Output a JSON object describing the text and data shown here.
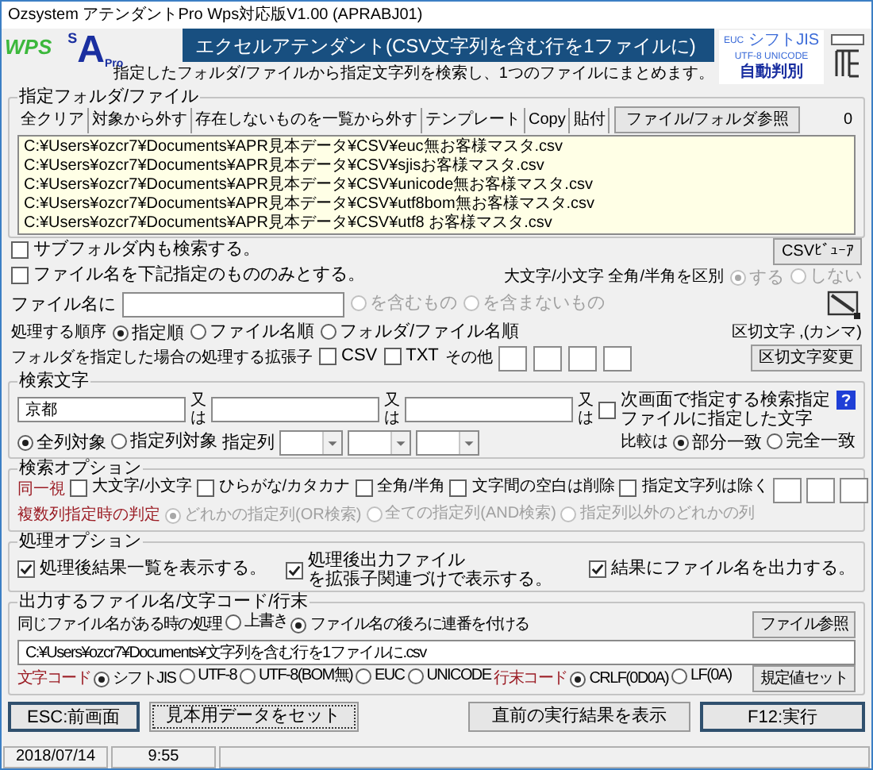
{
  "window": {
    "title": "Ozsystem アテンダントPro Wps対応版V1.00 (APRABJ01)"
  },
  "header": {
    "wps_logo": "WPS",
    "app_logo": {
      "top": "S",
      "main": "A",
      "bottom": "Pro"
    },
    "banner": "エクセルアテンダント(CSV文字列を含む行を1ファイルに)",
    "encoding_badge": {
      "line_1": [
        "EUC",
        "シフトJIS"
      ],
      "line_2": "UTF-8 UNICODE",
      "caption": "自動判別"
    },
    "subtitle": "指定したフォルダ/ファイルから指定文字列を検索し、1つのファイルにまとめます。"
  },
  "folder_group": {
    "title": "指定フォルダ/ファイル",
    "toolbar": [
      {
        "label": "全クリア",
        "kind": "flat"
      },
      {
        "label": "対象から外す",
        "kind": "flat"
      },
      {
        "label": "存在しないものを一覧から外す",
        "kind": "flat"
      },
      {
        "label": "テンプレート",
        "kind": "flat"
      },
      {
        "label": "Copy",
        "kind": "flat"
      },
      {
        "label": "貼付",
        "kind": "flat"
      },
      {
        "label": "ファイル/フォルダ参照",
        "kind": "raised"
      }
    ],
    "count": "0",
    "files": [
      "C:¥Users¥ozcr7¥Documents¥APR見本データ¥CSV¥euc無お客様マスタ.csv",
      "C:¥Users¥ozcr7¥Documents¥APR見本データ¥CSV¥sjisお客様マスタ.csv",
      "C:¥Users¥ozcr7¥Documents¥APR見本データ¥CSV¥unicode無お客様マスタ.csv",
      "C:¥Users¥ozcr7¥Documents¥APR見本データ¥CSV¥utf8bom無お客様マスタ.csv",
      "C:¥Users¥ozcr7¥Documents¥APR見本データ¥CSV¥utf8 お客様マスタ.csv"
    ]
  },
  "file_options": {
    "rows": [
      {
        "left": [
          {
            "kind": "checkbox",
            "label": "サブフォルダ内も検索する。",
            "checked": false,
            "disabled": false
          }
        ],
        "right": [
          {
            "kind": "button",
            "label": "CSVﾋﾞｭｰｱ"
          }
        ]
      },
      {
        "left": [
          {
            "kind": "checkbox",
            "label": "ファイル名を下記指定のもののみとする。",
            "checked": false,
            "disabled": false
          }
        ],
        "right": [
          {
            "kind": "note",
            "label": "大文字/小文字 全角/半角を区別"
          },
          {
            "kind": "radio",
            "label": "する",
            "selected": true,
            "disabled": true
          },
          {
            "kind": "radio",
            "label": "しない",
            "selected": false,
            "disabled": true
          }
        ]
      },
      {
        "left": [
          {
            "kind": "label",
            "label": "ファイル名に"
          },
          {
            "kind": "field"
          },
          {
            "kind": "radio",
            "label": "を含むもの",
            "selected": false,
            "disabled": true
          },
          {
            "kind": "radio",
            "label": "を含まないもの",
            "selected": false,
            "disabled": true
          }
        ],
        "right": []
      },
      {
        "left": [
          {
            "kind": "note",
            "label": "処理する順序"
          },
          {
            "kind": "radio",
            "label": "指定順",
            "selected": true,
            "disabled": false
          },
          {
            "kind": "radio",
            "label": "ファイル名順",
            "selected": false,
            "disabled": false
          },
          {
            "kind": "radio",
            "label": "フォルダ/ファイル名順",
            "selected": false,
            "disabled": false
          }
        ],
        "right": [
          {
            "kind": "note",
            "label": "区切文字 ,(カンマ)"
          }
        ]
      },
      {
        "left": [
          {
            "kind": "note",
            "label": "フォルダを指定した場合の処理する拡張子"
          },
          {
            "kind": "checkbox",
            "label": "CSV",
            "checked": false,
            "disabled": false
          },
          {
            "kind": "checkbox",
            "label": "TXT",
            "checked": false,
            "disabled": false
          },
          {
            "kind": "note",
            "label": "その他"
          },
          {
            "kind": "cell"
          },
          {
            "kind": "cell"
          },
          {
            "kind": "cell"
          },
          {
            "kind": "cell"
          }
        ],
        "right": [
          {
            "kind": "button",
            "label": "区切文字変更"
          }
        ]
      }
    ]
  },
  "search_group": {
    "title": "検索文字",
    "rows": [
      {
        "left": [
          {
            "kind": "field",
            "value": "京都"
          },
          {
            "kind": "stacked",
            "label": "又は"
          },
          {
            "kind": "field"
          },
          {
            "kind": "stacked",
            "label": "又は"
          },
          {
            "kind": "field"
          },
          {
            "kind": "stacked",
            "label": "又は"
          },
          {
            "kind": "checkbox",
            "lines": [
              "次画面で指定する検索指定",
              "ファイルに指定した文字"
            ],
            "checked": false,
            "disabled": false
          }
        ],
        "right": []
      },
      {
        "left": [
          {
            "kind": "radio",
            "label": "全列対象",
            "selected": true,
            "disabled": false
          },
          {
            "kind": "radio",
            "label": "指定列対象",
            "selected": false,
            "disabled": false
          },
          {
            "kind": "label",
            "label": "指定列"
          },
          {
            "kind": "select"
          },
          {
            "kind": "select"
          },
          {
            "kind": "select"
          }
        ],
        "right": [
          {
            "kind": "note",
            "label": "比較は"
          },
          {
            "kind": "radio",
            "label": "部分一致",
            "selected": true,
            "disabled": false
          },
          {
            "kind": "radio",
            "label": "完全一致",
            "selected": false,
            "disabled": false
          }
        ]
      }
    ]
  },
  "search_options": {
    "title": "検索オプション",
    "rows": [
      {
        "left": [
          {
            "kind": "caption",
            "label": "同一視"
          },
          {
            "kind": "checkbox",
            "label": "大文字/小文字",
            "checked": false,
            "disabled": false
          },
          {
            "kind": "checkbox",
            "label": "ひらがな/カタカナ",
            "checked": false,
            "disabled": false
          },
          {
            "kind": "checkbox",
            "label": "全角/半角",
            "checked": false,
            "disabled": false
          },
          {
            "kind": "checkbox",
            "label": "文字間の空白は削除",
            "checked": false,
            "disabled": false
          },
          {
            "kind": "checkbox",
            "label": "指定文字列は除く",
            "checked": false,
            "disabled": false
          },
          {
            "kind": "cell"
          },
          {
            "kind": "cell"
          },
          {
            "kind": "cell"
          }
        ],
        "right": []
      },
      {
        "left": [
          {
            "kind": "caption",
            "label": "複数列指定時の判定"
          },
          {
            "kind": "radio",
            "label": "どれかの指定列(OR検索)",
            "selected": true,
            "disabled": true
          },
          {
            "kind": "radio",
            "label": "全ての指定列(AND検索)",
            "selected": false,
            "disabled": true
          },
          {
            "kind": "radio",
            "label": "指定列以外のどれかの列",
            "selected": false,
            "disabled": true
          }
        ],
        "right": []
      }
    ]
  },
  "process_options": {
    "title": "処理オプション",
    "rows": [
      {
        "left": [
          {
            "kind": "checkbox",
            "label": "処理後結果一覧を表示する。",
            "checked": true,
            "disabled": false
          },
          {
            "kind": "checkbox",
            "lines": [
              "処理後出力ファイル",
              "を拡張子関連づけで表示する。"
            ],
            "checked": true,
            "disabled": false
          }
        ],
        "right": [
          {
            "kind": "checkbox",
            "label": "結果にファイル名を出力する。",
            "checked": true,
            "disabled": false
          }
        ]
      }
    ]
  },
  "output_group": {
    "title": "出力するファイル名/文字コード/行末",
    "rows": [
      {
        "left": [
          {
            "kind": "note",
            "label": "同じファイル名がある時の処理"
          },
          {
            "kind": "radio",
            "label": "上書き",
            "selected": false,
            "disabled": false
          },
          {
            "kind": "radio",
            "label": "ファイル名の後ろに連番を付ける",
            "selected": true,
            "disabled": false
          }
        ],
        "right": [
          {
            "kind": "button",
            "label": "ファイル参照"
          }
        ]
      },
      {
        "left": [
          {
            "kind": "field",
            "value": "C:¥Users¥ozcr7¥Documents¥文字列を含む行を1ファイルに.csv"
          }
        ],
        "right": []
      },
      {
        "left": [
          {
            "kind": "caption",
            "label": "文字コード"
          },
          {
            "kind": "radio",
            "label": "シフトJIS",
            "selected": true,
            "disabled": false
          },
          {
            "kind": "radio",
            "label": "UTF-8",
            "selected": false,
            "disabled": false
          },
          {
            "kind": "radio",
            "label": "UTF-8(BOM無)",
            "selected": false,
            "disabled": false
          },
          {
            "kind": "radio",
            "label": "EUC",
            "selected": false,
            "disabled": false
          },
          {
            "kind": "radio",
            "label": "UNICODE",
            "selected": false,
            "disabled": false
          },
          {
            "kind": "caption",
            "label": "行末コード"
          },
          {
            "kind": "radio",
            "label": "CRLF(0D0A)",
            "selected": true,
            "disabled": false
          },
          {
            "kind": "radio",
            "label": "LF(0A)",
            "selected": false,
            "disabled": false
          }
        ],
        "right": [
          {
            "kind": "button",
            "label": "規定値セット"
          }
        ]
      }
    ]
  },
  "buttons": {
    "left": [
      {
        "label": "ESC:前画面",
        "kind": "default"
      },
      {
        "label": "見本用データをセット",
        "kind": "focused"
      }
    ],
    "right": [
      {
        "label": "直前の実行結果を表示",
        "kind": "normal"
      },
      {
        "label": "F12:実行",
        "kind": "default"
      }
    ]
  },
  "status_bar": [
    "2018/07/14",
    "9:55"
  ]
}
